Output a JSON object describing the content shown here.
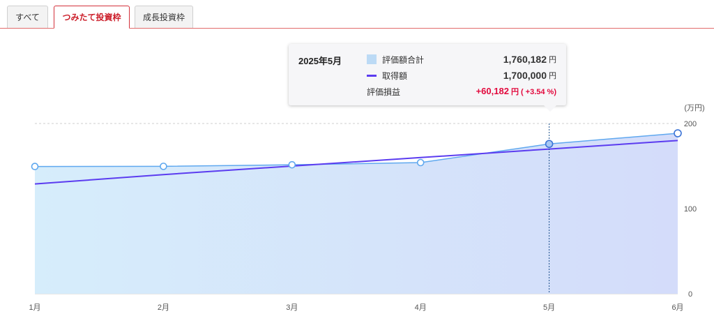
{
  "tabs": [
    {
      "label": "すべて",
      "active": false
    },
    {
      "label": "つみたて投資枠",
      "active": true
    },
    {
      "label": "成長投資枠",
      "active": false
    }
  ],
  "colors": {
    "accent": "#d3303a",
    "area_fill_left": "#d6edfb",
    "area_fill_right": "#d4dcfa",
    "valuation_line": "#5fa8ef",
    "cost_line": "#5b3cf0",
    "gain": "#e2093d"
  },
  "tooltip": {
    "date": "2025年5月",
    "rows": [
      {
        "label": "評価額合計",
        "value": "1,760,182",
        "unit": "円",
        "swatch": "area"
      },
      {
        "label": "取得額",
        "value": "1,700,000",
        "unit": "円",
        "swatch": "line"
      }
    ],
    "gain_label": "評価損益",
    "gain_value": "+60,182",
    "gain_unit": "円",
    "gain_pct": "( +3.54 %)"
  },
  "chart_data": {
    "type": "area",
    "categories": [
      "1月",
      "2月",
      "3月",
      "4月",
      "5月",
      "6月"
    ],
    "y_unit": "(万円)",
    "y_ticks": [
      0,
      100,
      200
    ],
    "ylim": [
      0,
      200
    ],
    "grid": true,
    "series": [
      {
        "name": "評価額合計",
        "style": "area",
        "values": [
          149.5,
          149.7,
          151.5,
          154.1,
          176.0182,
          188.5
        ]
      },
      {
        "name": "取得額",
        "style": "line",
        "values": [
          129,
          140,
          150,
          160,
          170,
          180
        ]
      }
    ],
    "highlight_index": 4
  }
}
